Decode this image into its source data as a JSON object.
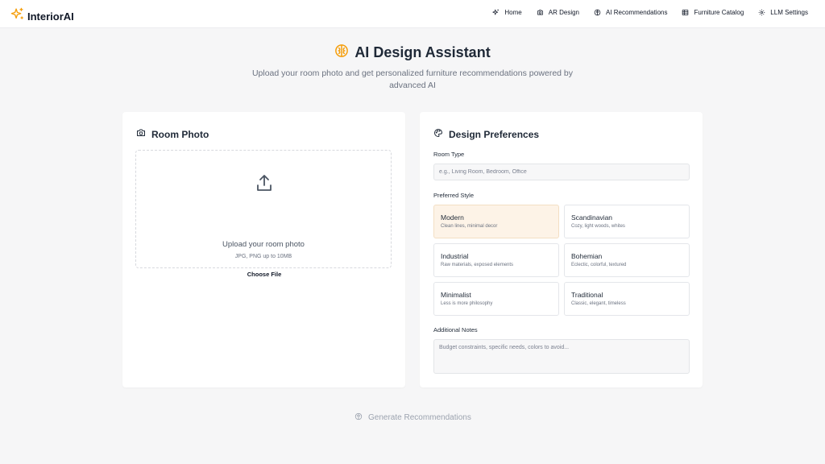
{
  "brand": {
    "name": "InteriorAI",
    "accent": "#f59e0b"
  },
  "nav": {
    "items": [
      {
        "label": "Home",
        "icon": "sparkles-icon"
      },
      {
        "label": "AR Design",
        "icon": "camera-icon"
      },
      {
        "label": "AI Recommendations",
        "icon": "brain-icon"
      },
      {
        "label": "Furniture Catalog",
        "icon": "grid-icon"
      },
      {
        "label": "LLM Settings",
        "icon": "gear-icon"
      }
    ]
  },
  "hero": {
    "title": "AI Design Assistant",
    "subtitle": "Upload your room photo and get personalized furniture recommendations powered by advanced AI"
  },
  "room_photo": {
    "title": "Room Photo",
    "upload_title": "Upload your room photo",
    "upload_hint": "JPG, PNG up to 10MB",
    "choose_file": "Choose File"
  },
  "preferences": {
    "title": "Design Preferences",
    "room_type_label": "Room Type",
    "room_type_placeholder": "e.g., Living Room, Bedroom, Office",
    "style_label": "Preferred Style",
    "selected_style": "Modern",
    "styles": [
      {
        "name": "Modern",
        "desc": "Clean lines, minimal decor"
      },
      {
        "name": "Scandinavian",
        "desc": "Cozy, light woods, whites"
      },
      {
        "name": "Industrial",
        "desc": "Raw materials, exposed elements"
      },
      {
        "name": "Bohemian",
        "desc": "Eclectic, colorful, textured"
      },
      {
        "name": "Minimalist",
        "desc": "Less is more philosophy"
      },
      {
        "name": "Traditional",
        "desc": "Classic, elegant, timeless"
      }
    ],
    "notes_label": "Additional Notes",
    "notes_placeholder": "Budget constraints, specific needs, colors to avoid..."
  },
  "actions": {
    "generate_label": "Generate Recommendations"
  },
  "colors": {
    "selected_bg": "#fdf3e7",
    "muted": "#9ca3af"
  }
}
